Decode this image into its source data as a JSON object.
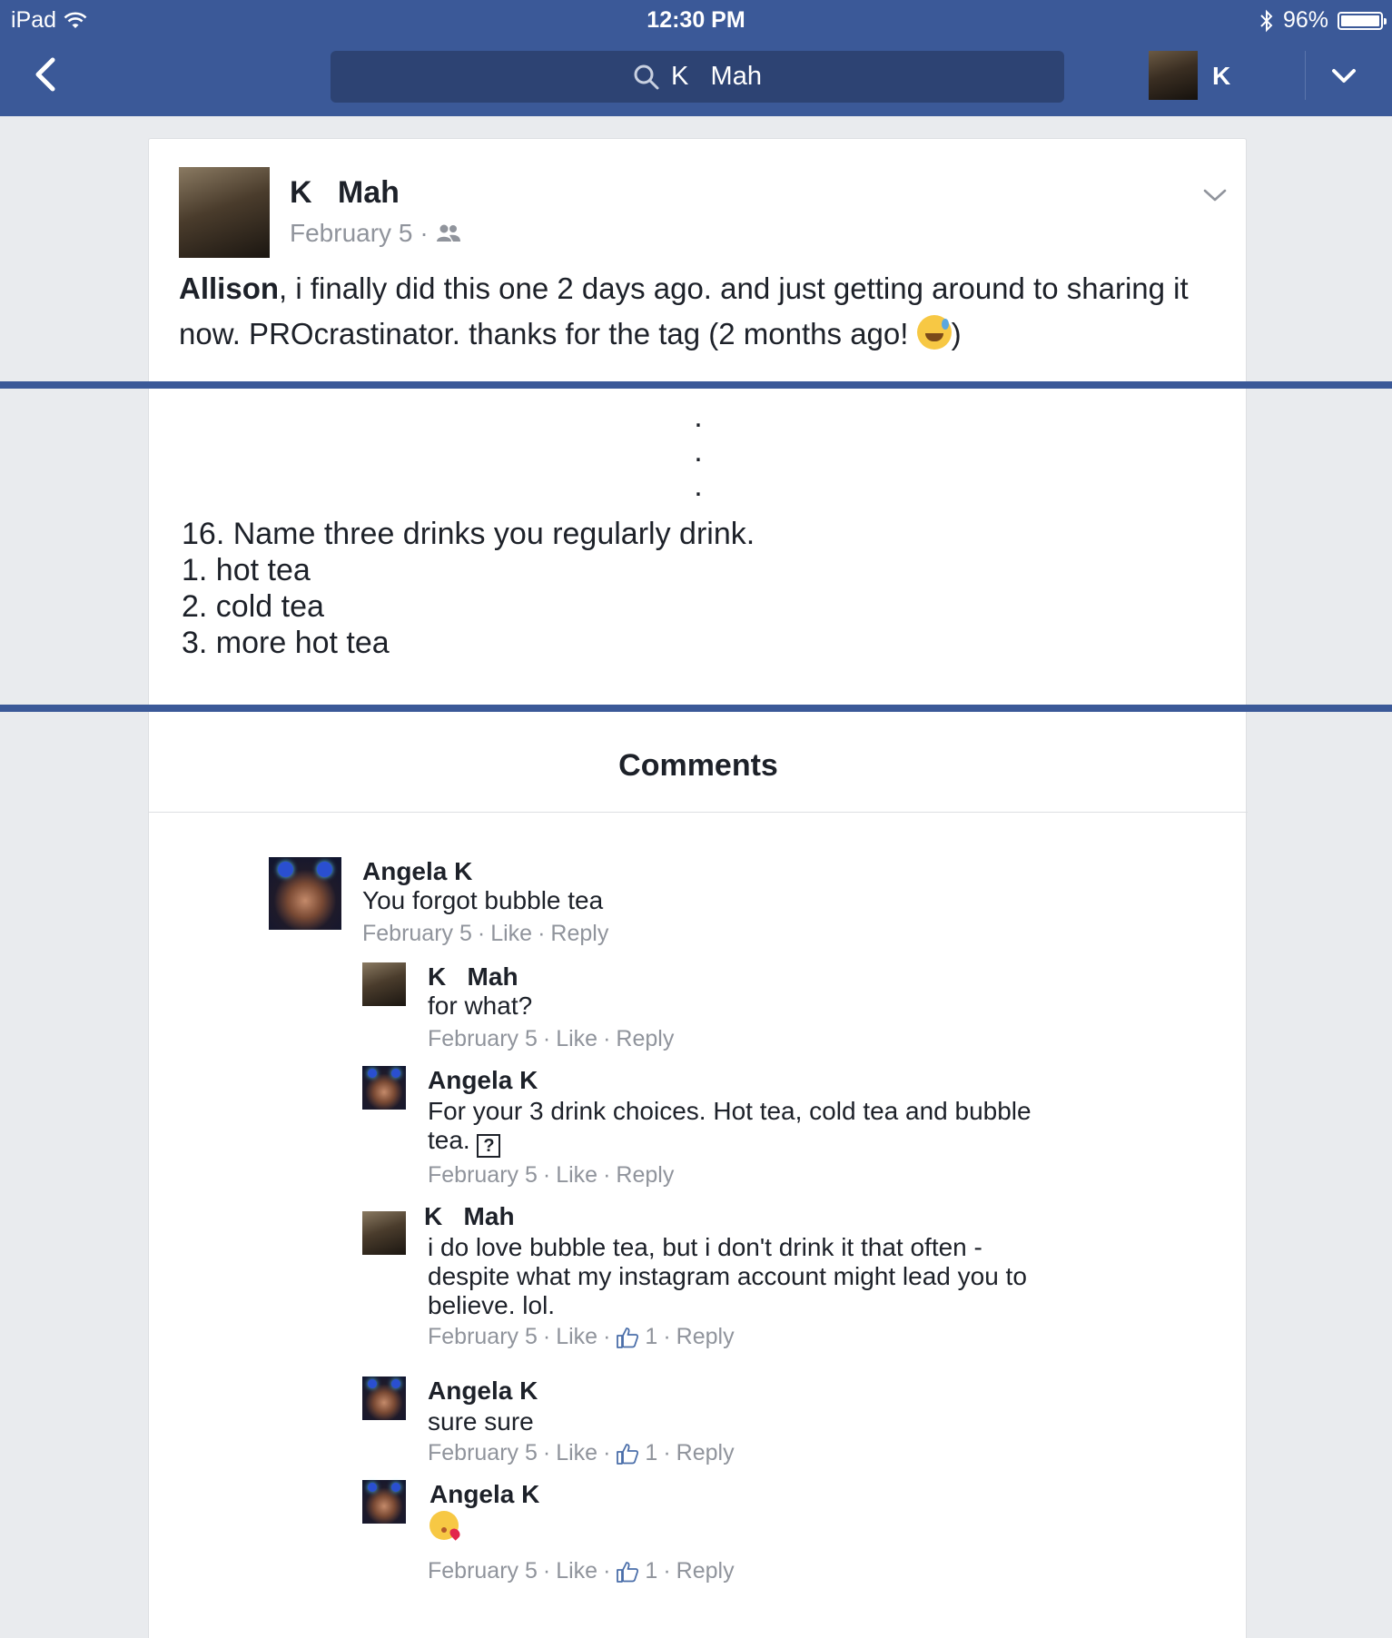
{
  "status_bar": {
    "device": "iPad",
    "time": "12:30 PM",
    "battery": "96%",
    "battery_level": 0.96
  },
  "nav": {
    "back_icon": "chevron-left-icon",
    "search_text": "K   Mah",
    "profile_name": "K",
    "menu_icon": "chevron-down-icon"
  },
  "post": {
    "author": "K   Mah",
    "date": "February 5",
    "audience_icon": "friends-icon",
    "mention": "Allison",
    "text": ", i finally did this one 2 days ago. and just getting around to sharing it now. PROcrastinator. thanks for the tag (2 months ago! ",
    "text_end": ")",
    "ellipsis": [
      ".",
      ".",
      "."
    ],
    "question": "16. Name three drinks you regularly drink.",
    "answers": [
      "1. hot tea",
      "2. cold tea",
      "3. more hot tea"
    ]
  },
  "comments_section": {
    "title": "Comments"
  },
  "comments": [
    {
      "name": "Angela K",
      "text": "You forgot bubble tea",
      "date": "February 5",
      "like": "Like",
      "reply": "Reply"
    },
    {
      "name": "K   Mah",
      "text": "for what?",
      "date": "February 5",
      "like": "Like",
      "reply": "Reply"
    },
    {
      "name": "Angela K",
      "text": "For your 3 drink choices. Hot tea, cold tea and bubble tea.",
      "date": "February 5",
      "like": "Like",
      "reply": "Reply",
      "glyph": "?"
    },
    {
      "name": "K   Mah",
      "text": "i do love bubble tea, but i don't drink it that often - despite what my instagram account might lead you to believe. lol.",
      "date": "February 5",
      "like": "Like",
      "likes_count": "1",
      "reply": "Reply"
    },
    {
      "name": "Angela K",
      "text": "sure sure",
      "date": "February 5",
      "like": "Like",
      "likes_count": "1",
      "reply": "Reply"
    },
    {
      "name": "Angela K",
      "text": "",
      "emoji": "kissing-face-icon",
      "date": "February 5",
      "like": "Like",
      "likes_count": "1",
      "reply": "Reply"
    }
  ],
  "colors": {
    "brand": "#3b5998",
    "meta_text": "#90949c",
    "background": "#e9ebee"
  }
}
